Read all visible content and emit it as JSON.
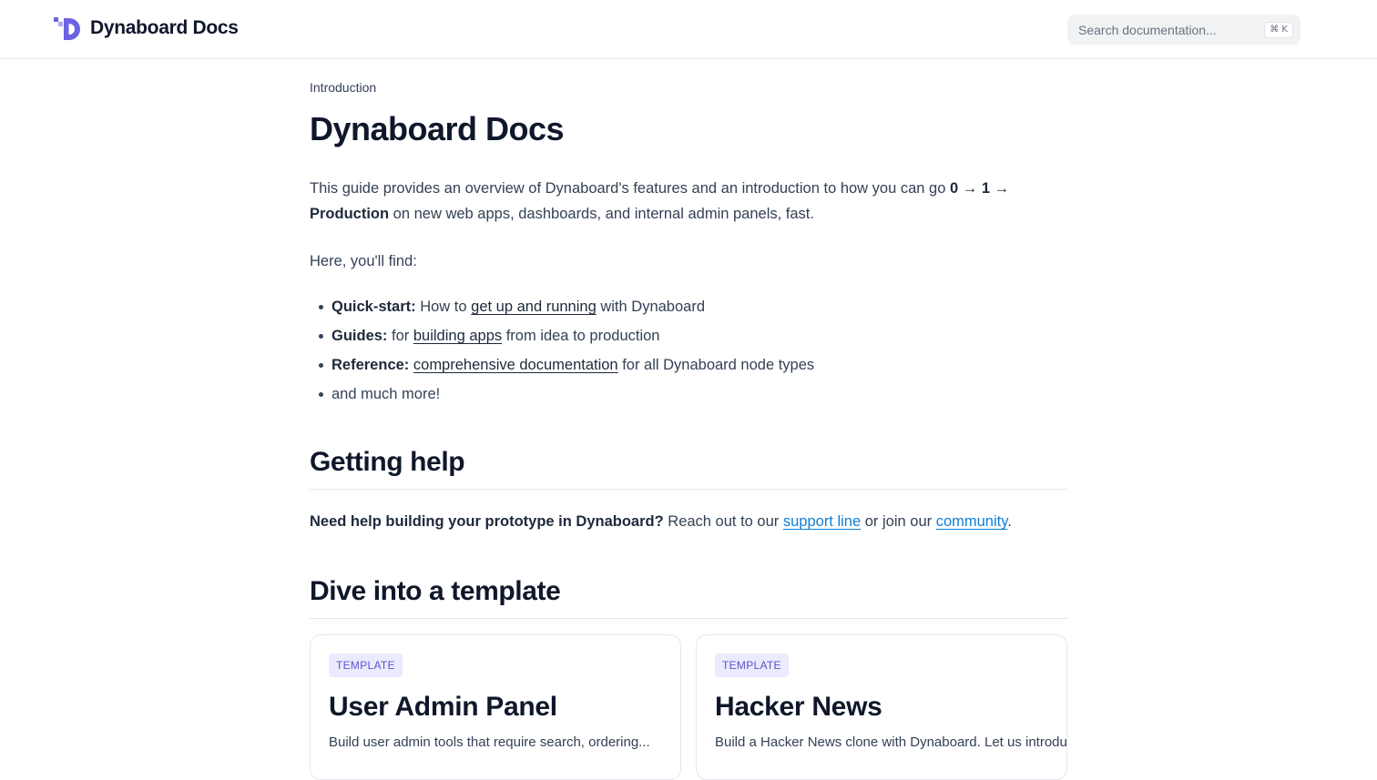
{
  "header": {
    "brand_name": "Dynaboard Docs",
    "search_placeholder": "Search documentation...",
    "search_shortcut": "⌘ K"
  },
  "colors": {
    "brand": "#6c63e0",
    "link_blue": "#0e7fd6",
    "badge_bg": "#eceafd",
    "badge_text": "#5b55c9"
  },
  "page": {
    "eyebrow": "Introduction",
    "title": "Dynaboard Docs",
    "lead": {
      "text_before": "This guide provides an overview of Dynaboard's features and an introduction to how you can go ",
      "highlight": "0 → 1 → Production",
      "text_after": " on new web apps, dashboards, and internal admin panels, fast."
    },
    "find_intro": "Here, you'll find:",
    "features": [
      {
        "label": "Quick-start:",
        "before": " How to ",
        "link": "get up and running",
        "after": " with Dynaboard"
      },
      {
        "label": "Guides:",
        "before": " for ",
        "link": "building apps",
        "after": " from idea to production"
      },
      {
        "label": "Reference:",
        "before": " ",
        "link": "comprehensive documentation",
        "after": " for all Dynaboard node types"
      },
      {
        "text": "and much more!"
      }
    ]
  },
  "help": {
    "heading": "Getting help",
    "bold": "Need help building your prototype in Dynaboard?",
    "text_1": " Reach out to our ",
    "link_1": "support line",
    "text_2": " or join our ",
    "link_2": "community",
    "text_3": "."
  },
  "templates": {
    "heading": "Dive into a template",
    "cards": [
      {
        "badge": "TEMPLATE",
        "title": "User Admin Panel",
        "description": "Build user admin tools that require search, ordering..."
      },
      {
        "badge": "TEMPLATE",
        "title": "Hacker News",
        "description": "Build a Hacker News clone with Dynaboard. Let us introduce..."
      }
    ]
  }
}
